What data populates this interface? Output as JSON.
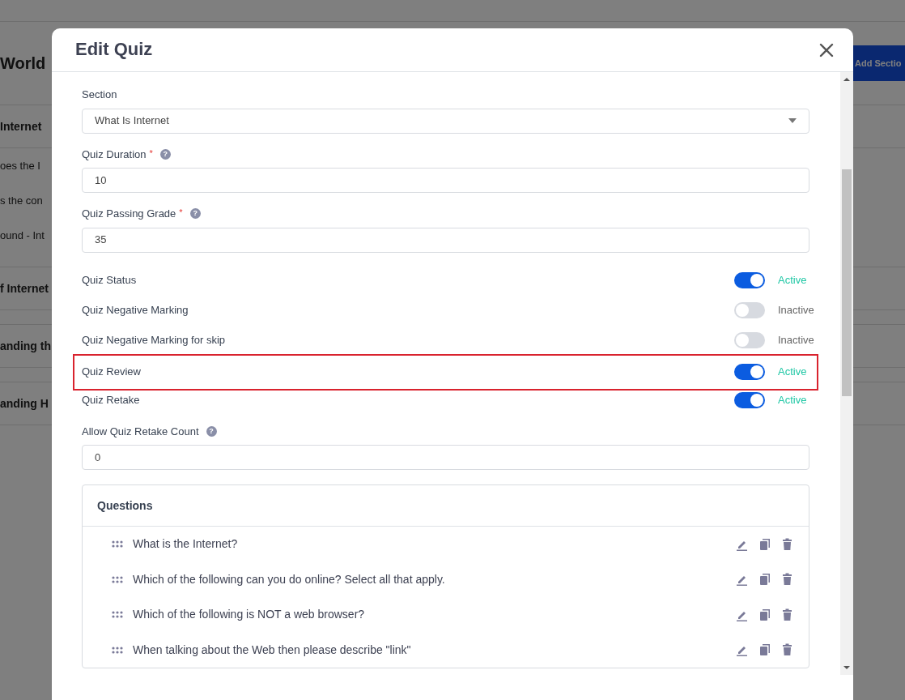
{
  "background_page": {
    "heading": "World",
    "add_button": "Add Sectio",
    "rows": [
      {
        "kind": "title",
        "text": "Internet"
      },
      {
        "kind": "lesson",
        "text": "oes the I"
      },
      {
        "kind": "lesson",
        "text": "s the con"
      },
      {
        "kind": "lesson",
        "text": "ound - Int"
      },
      {
        "kind": "title",
        "text": "f Internet"
      },
      {
        "kind": "title",
        "text": "anding th"
      },
      {
        "kind": "title",
        "text": "anding H"
      }
    ]
  },
  "modal": {
    "title": "Edit Quiz",
    "form": [
      {
        "kind": "select",
        "label": "Section",
        "value": "What Is Internet"
      },
      {
        "kind": "input",
        "label": "Quiz Duration",
        "required_mark": "*",
        "help": "?",
        "value": "10"
      },
      {
        "kind": "input",
        "label": "Quiz Passing Grade",
        "required_mark": "*",
        "help": "?",
        "value": "35"
      },
      {
        "kind": "toggle",
        "label": "Quiz Status",
        "on": true,
        "status": "Active",
        "highlighted": false
      },
      {
        "kind": "toggle",
        "label": "Quiz Negative Marking",
        "on": false,
        "status": "Inactive",
        "highlighted": false
      },
      {
        "kind": "toggle",
        "label": "Quiz Negative Marking for skip",
        "on": false,
        "status": "Inactive",
        "highlighted": false
      },
      {
        "kind": "toggle",
        "label": "Quiz Review",
        "on": true,
        "status": "Active",
        "highlighted": true
      },
      {
        "kind": "toggle",
        "label": "Quiz Retake",
        "on": true,
        "status": "Active",
        "highlighted": false
      },
      {
        "kind": "input",
        "label": "Allow Quiz Retake Count",
        "help": "?",
        "value": "0"
      }
    ],
    "questions": {
      "title": "Questions",
      "items": [
        {
          "text": "What is the Internet?"
        },
        {
          "text": "Which of the following can you do online? Select all that apply."
        },
        {
          "text": "Which of the following is NOT a web browser?"
        },
        {
          "text": "When talking about the Web then please describe \"link\""
        }
      ]
    }
  }
}
